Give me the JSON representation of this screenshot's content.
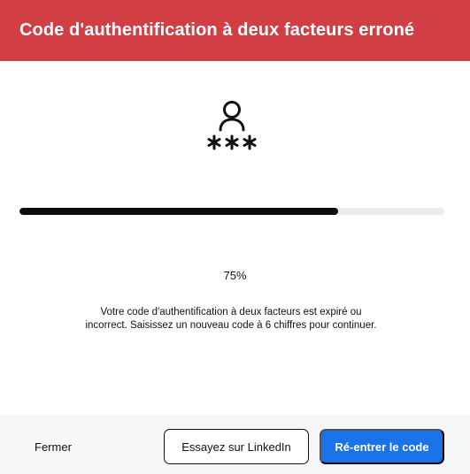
{
  "dialog": {
    "title": "Code d'authentification à deux facteurs erroné",
    "icon": "user-password-icon",
    "progress": {
      "percent_value": 75,
      "percent_label": "75%"
    },
    "message": "Votre code d'authentification à deux facteurs est expiré ou incorrect. Saisissez un nouveau code à 6 chiffres pour continuer.",
    "buttons": {
      "close": "Fermer",
      "linkedin": "Essayez sur LinkedIn",
      "reenter": "Ré-entrer le code"
    }
  },
  "colors": {
    "header_bg": "#d13f45",
    "primary": "#1a73e8",
    "progress_fill": "#0d0d0d",
    "progress_track": "#ececec",
    "footer_bg": "#f6f7f9"
  }
}
